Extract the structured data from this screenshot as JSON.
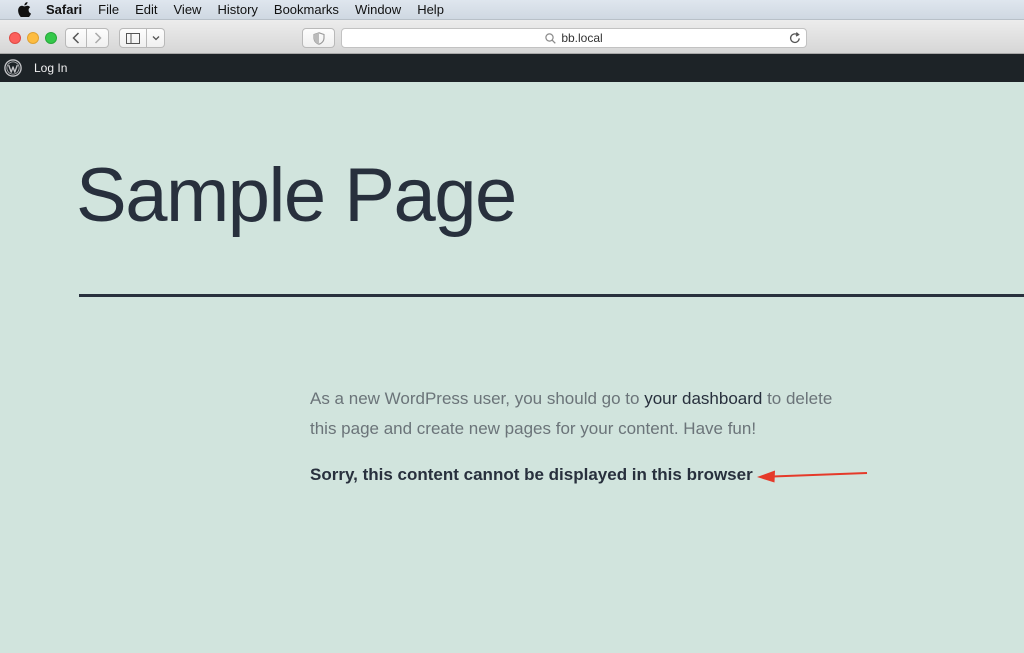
{
  "menubar": {
    "app": "Safari",
    "items": [
      "File",
      "Edit",
      "View",
      "History",
      "Bookmarks",
      "Window",
      "Help"
    ]
  },
  "browser": {
    "address": "bb.local"
  },
  "adminbar": {
    "login_label": "Log In"
  },
  "page": {
    "title": "Sample Page",
    "para_before": "As a new WordPress user, you should go to ",
    "para_link": "your dashboard",
    "para_after": " to delete this page and create new pages for your content. Have fun!",
    "notice": "Sorry, this content cannot be displayed in this browser"
  },
  "colors": {
    "page_background": "#d1e4dd",
    "heading_text": "#28303d",
    "body_text": "#6b7479",
    "admin_bar": "#1d2327",
    "annotation_arrow": "#e53a2a"
  },
  "icons": {
    "menubar": "apple-icon",
    "toolbar": [
      "back-chevron-icon",
      "forward-chevron-icon",
      "sidebar-icon",
      "chevron-down-icon",
      "shield-icon",
      "search-icon",
      "reload-icon"
    ],
    "adminbar": "wordpress-logo-icon",
    "annotation": "red-arrow-icon"
  }
}
